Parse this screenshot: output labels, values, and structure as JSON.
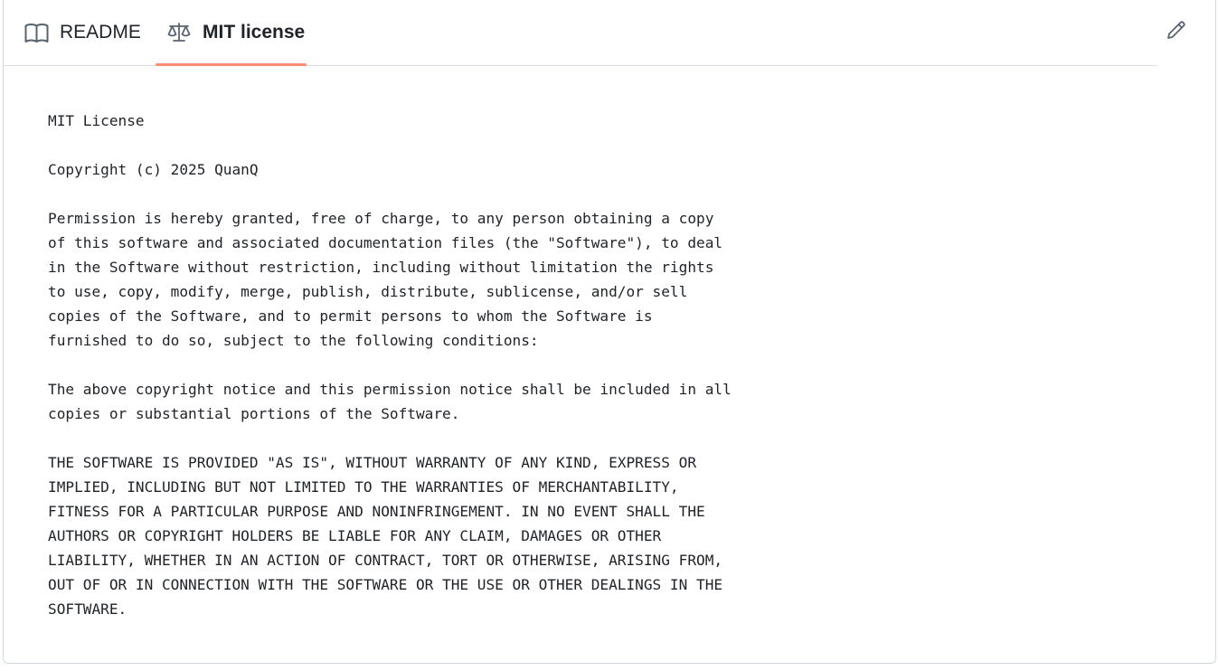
{
  "tabs": [
    {
      "label": "README",
      "icon": "book-icon",
      "active": false
    },
    {
      "label": "MIT license",
      "icon": "law-icon",
      "active": true
    }
  ],
  "toolbar": {
    "edit_icon": "pencil-icon"
  },
  "colors": {
    "active_underline": "#fd8c73",
    "text": "#1f2328",
    "border": "#d0d7de",
    "icon": "#59636e"
  },
  "license": {
    "text": "MIT License\n\nCopyright (c) 2025 QuanQ\n\nPermission is hereby granted, free of charge, to any person obtaining a copy\nof this software and associated documentation files (the \"Software\"), to deal\nin the Software without restriction, including without limitation the rights\nto use, copy, modify, merge, publish, distribute, sublicense, and/or sell\ncopies of the Software, and to permit persons to whom the Software is\nfurnished to do so, subject to the following conditions:\n\nThe above copyright notice and this permission notice shall be included in all\ncopies or substantial portions of the Software.\n\nTHE SOFTWARE IS PROVIDED \"AS IS\", WITHOUT WARRANTY OF ANY KIND, EXPRESS OR\nIMPLIED, INCLUDING BUT NOT LIMITED TO THE WARRANTIES OF MERCHANTABILITY,\nFITNESS FOR A PARTICULAR PURPOSE AND NONINFRINGEMENT. IN NO EVENT SHALL THE\nAUTHORS OR COPYRIGHT HOLDERS BE LIABLE FOR ANY CLAIM, DAMAGES OR OTHER\nLIABILITY, WHETHER IN AN ACTION OF CONTRACT, TORT OR OTHERWISE, ARISING FROM,\nOUT OF OR IN CONNECTION WITH THE SOFTWARE OR THE USE OR OTHER DEALINGS IN THE\nSOFTWARE."
  }
}
